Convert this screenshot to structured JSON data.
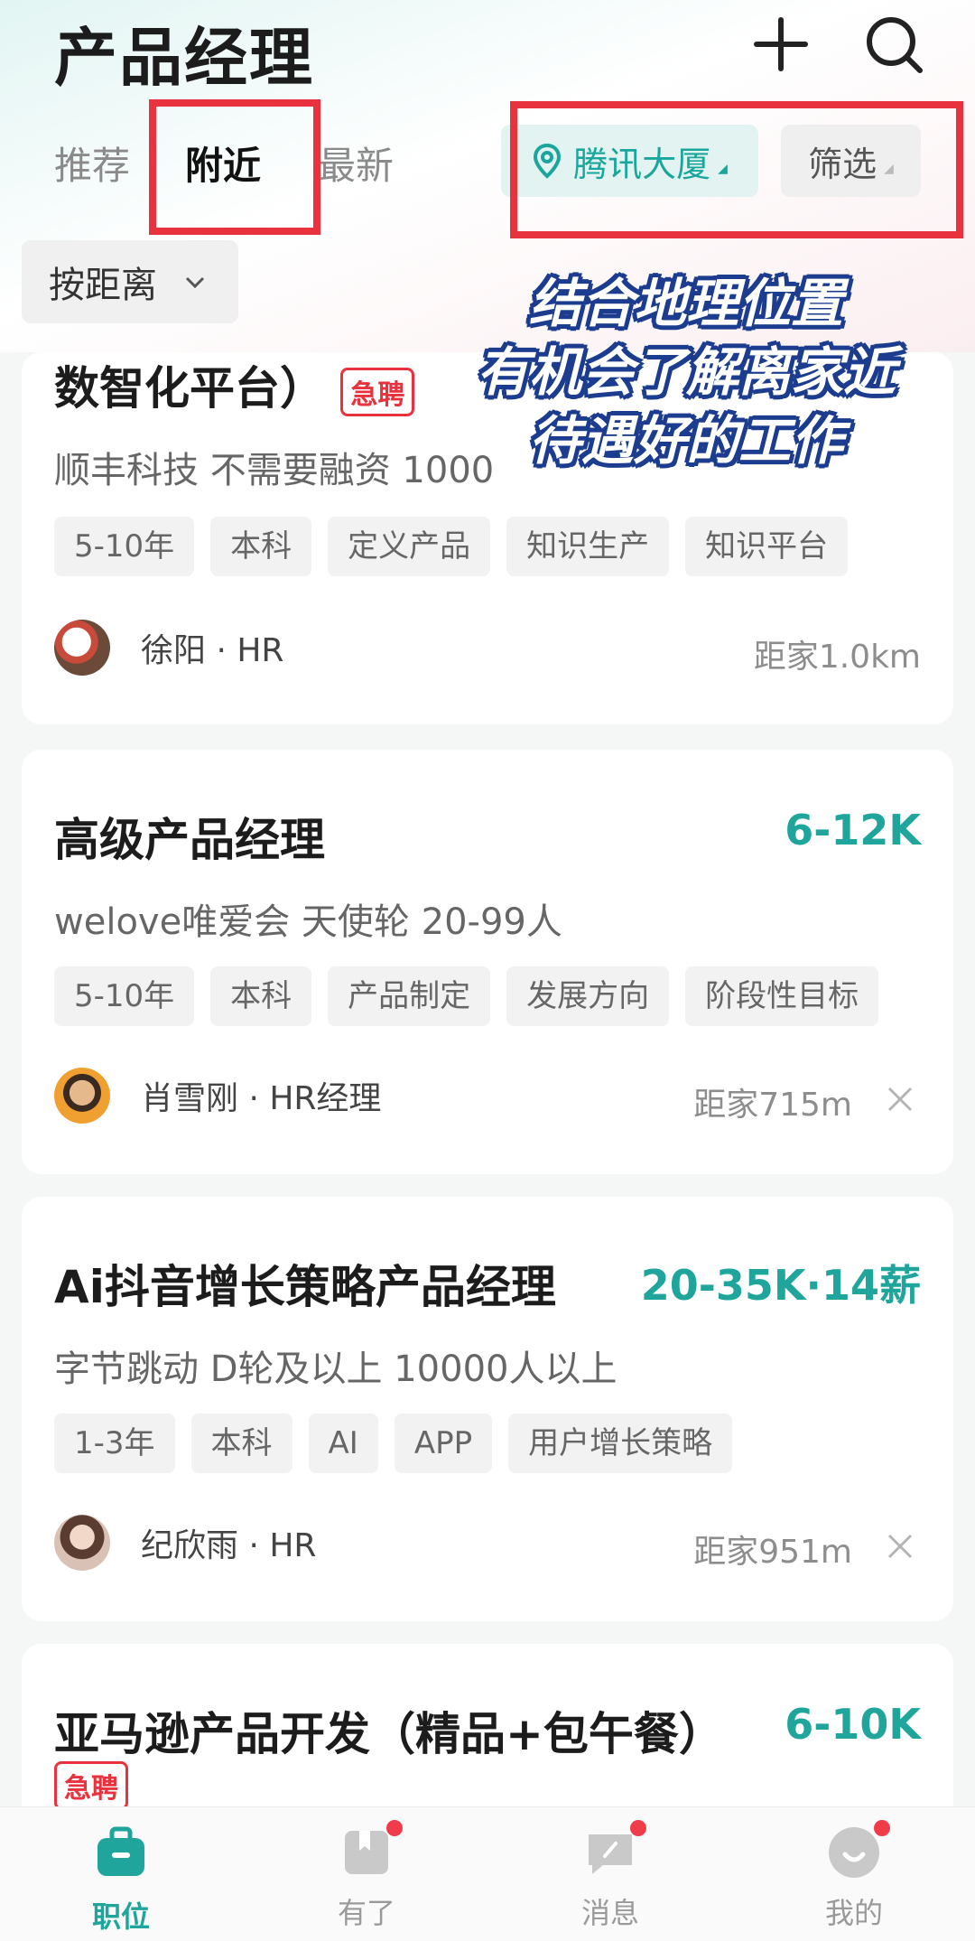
{
  "header": {
    "title": "产品经理"
  },
  "tabs": [
    {
      "label": "推荐"
    },
    {
      "label": "附近"
    },
    {
      "label": "最新"
    }
  ],
  "location_filter": {
    "label": "腾讯大厦"
  },
  "filter_button": {
    "label": "筛选"
  },
  "sort": {
    "label": "按距离"
  },
  "overlay_caption": {
    "line1": "结合地理位置",
    "line2": "有机会了解离家近",
    "line3": "待遇好的工作"
  },
  "jobs": [
    {
      "title": "数智化平台）",
      "urgent_badge": "急聘",
      "company": "顺丰科技  不需要融资  1000",
      "tags": [
        "5-10年",
        "本科",
        "定义产品",
        "知识生产",
        "知识平台"
      ],
      "recruiter": "徐阳 · HR",
      "distance": "距家1.0km"
    },
    {
      "title": "高级产品经理",
      "salary": "6-12K",
      "company": "welove唯爱会  天使轮  20-99人",
      "tags": [
        "5-10年",
        "本科",
        "产品制定",
        "发展方向",
        "阶段性目标"
      ],
      "recruiter": "肖雪刚 · HR经理",
      "distance": "距家715m"
    },
    {
      "title": "Ai抖音增长策略产品经理",
      "salary": "20-35K·14薪",
      "company": "字节跳动  D轮及以上  10000人以上",
      "tags": [
        "1-3年",
        "本科",
        "AI",
        "APP",
        "用户增长策略"
      ],
      "recruiter": "纪欣雨 · HR",
      "distance": "距家951m"
    },
    {
      "title": "亚马逊产品开发（精品+包午餐）",
      "salary": "6-10K",
      "urgent_badge": "急聘"
    }
  ],
  "bottom_nav": [
    {
      "label": "职位",
      "icon": "briefcase-icon"
    },
    {
      "label": "有了",
      "icon": "book-icon"
    },
    {
      "label": "消息",
      "icon": "chat-icon"
    },
    {
      "label": "我的",
      "icon": "profile-icon"
    }
  ],
  "colors": {
    "accent": "#1fa59b",
    "urgent": "#e8323d",
    "annotation_box": "#e8323d"
  }
}
